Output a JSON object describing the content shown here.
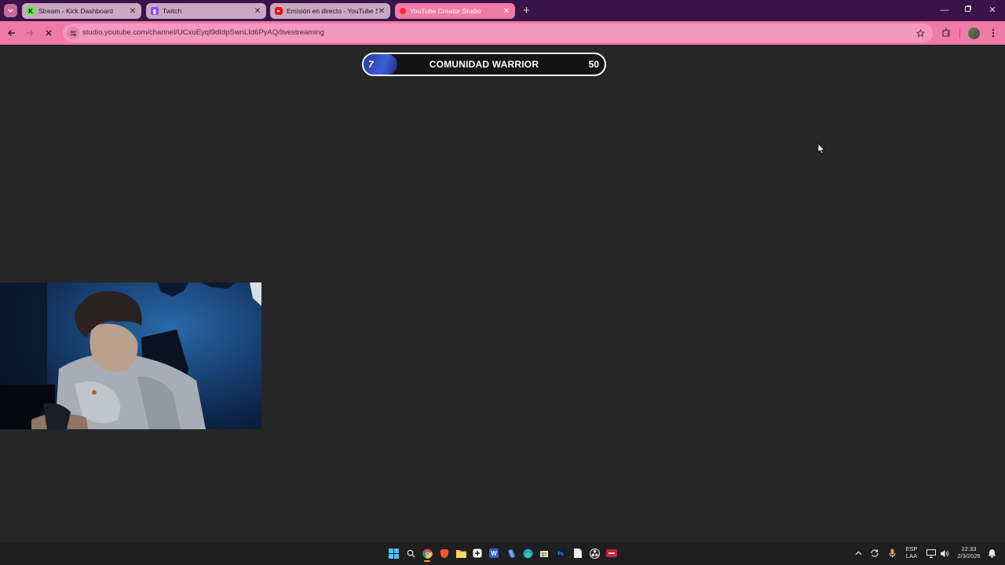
{
  "browser": {
    "tabs": [
      {
        "title": "Stream - Kick Dashboard",
        "favicon": "kick-icon"
      },
      {
        "title": "Twitch",
        "favicon": "twitch-icon"
      },
      {
        "title": "Emisión en directo - YouTube S",
        "favicon": "youtube-icon"
      },
      {
        "title": "YouTube Creator Studio",
        "favicon": "youtube-studio-icon",
        "active": true
      }
    ],
    "url": "studio.youtube.com/channel/UCxuEyqI9dIdpSwnLId6PyAQ/livestreaming"
  },
  "overlay": {
    "level": "7",
    "title": "COMUNIDAD WARRIOR",
    "goal": "50",
    "progress_fraction": 0.14
  },
  "taskbar": {
    "language_top": "ESP",
    "language_bottom": "LAA",
    "time": "22:33",
    "date": "2/3/2026"
  },
  "colors": {
    "tab_strip": "#3a1448",
    "toolbar_accent": "#ef7aa6",
    "page_background": "#262626",
    "overlay_fill": "#3d5ed8"
  }
}
